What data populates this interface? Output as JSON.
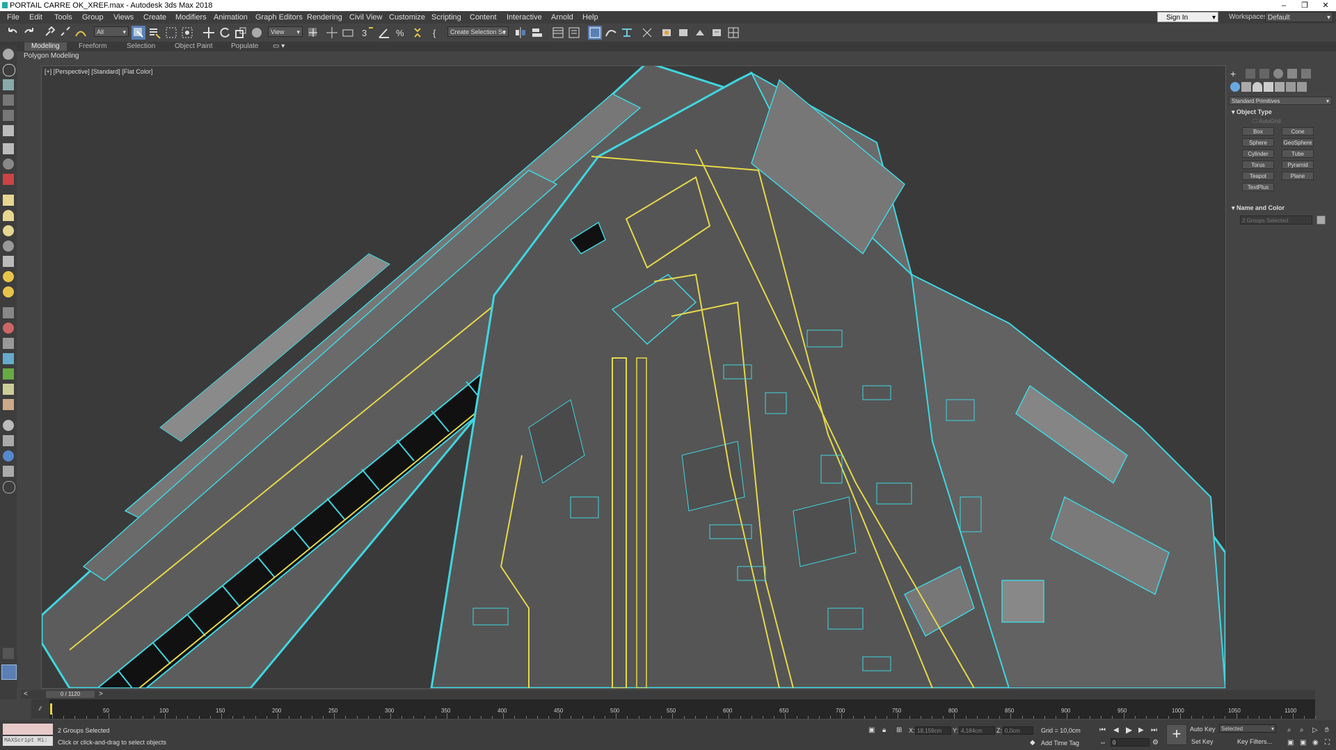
{
  "window": {
    "title": "PORTAIL CARRE OK_XREF.max - Autodesk 3ds Max 2018",
    "controls": [
      "–",
      "❐",
      "✕"
    ]
  },
  "menu": {
    "items": [
      "File",
      "Edit",
      "Tools",
      "Group",
      "Views",
      "Create",
      "Modifiers",
      "Animation",
      "Graph Editors",
      "Rendering",
      "Civil View",
      "Customize",
      "Scripting",
      "Content",
      "Interactive",
      "Arnold",
      "Help"
    ],
    "sign_in": "Sign In",
    "workspaces_label": "Workspaces:",
    "workspace_value": "Default"
  },
  "toolbar": {
    "selection_filter": "All",
    "ref_coord": "View",
    "named_selection_placeholder": "Create Selection Se"
  },
  "ribbon": {
    "tabs": [
      "Modeling",
      "Freeform",
      "Selection",
      "Object Paint",
      "Populate"
    ],
    "active_tab": "Modeling",
    "panel_label": "Polygon Modeling"
  },
  "viewport": {
    "label": "[+] [Perspective] [Standard] [Flat Color]"
  },
  "command_panel": {
    "category": "Standard Primitives",
    "object_type_header": "Object Type",
    "autogrid_label": "AutoGrid",
    "buttons": [
      "Box",
      "Cone",
      "Sphere",
      "GeoSphere",
      "Cylinder",
      "Tube",
      "Torus",
      "Pyramid",
      "Teapot",
      "Plane",
      "TextPlus"
    ],
    "name_color_header": "Name and Color",
    "name_field": "2 Groups Selected"
  },
  "timeline": {
    "slider": "0 / 1120",
    "tick_labels": [
      "50",
      "100",
      "150",
      "200",
      "250",
      "300",
      "350",
      "400",
      "450",
      "500",
      "550",
      "600",
      "650",
      "700",
      "750",
      "800",
      "850",
      "900",
      "950",
      "1000",
      "1050",
      "1100"
    ]
  },
  "status": {
    "maxscript_placeholder": "MAXScript Mi:",
    "selection_status": "2 Groups Selected",
    "prompt": "Click or click-and-drag to select objects",
    "x_label": "X:",
    "x_value": "18,159cm",
    "y_label": "Y:",
    "y_value": "4,184cm",
    "z_label": "Z:",
    "z_value": "0,0cm",
    "grid": "Grid = 10,0cm",
    "add_time_tag": "Add Time Tag",
    "auto_key": "Auto Key",
    "set_key": "Set Key",
    "key_mode": "Selected",
    "key_filters": "Key Filters...",
    "frame": "0"
  },
  "colors": {
    "wire_cyan": "#3fd6e0",
    "wire_yellow": "#e6d84a",
    "bg": "#3a3a3a"
  }
}
